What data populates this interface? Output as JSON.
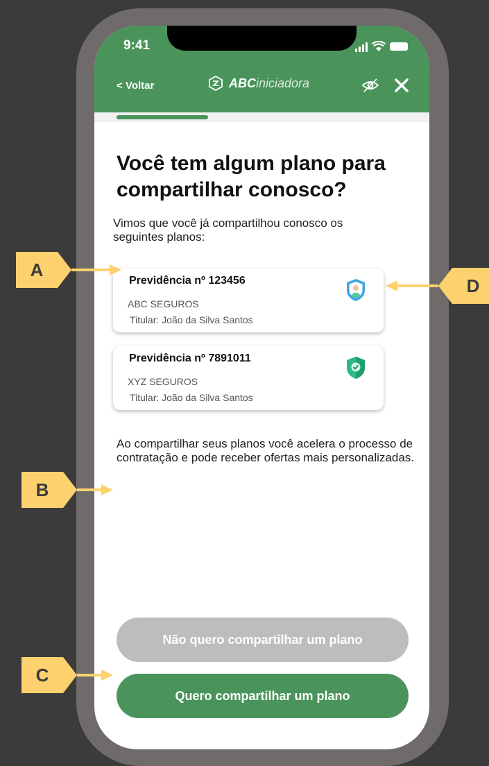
{
  "status_bar": {
    "time": "9:41"
  },
  "header": {
    "back_label": "< Voltar",
    "brand_strong": "ABC",
    "brand_light": "iniciadora"
  },
  "progress": {
    "fraction": 0.25
  },
  "title": "Você tem algum plano para compartilhar conosco?",
  "subtitle": "Vimos que você já compartilhou conosco os seguintes planos:",
  "plans": [
    {
      "title": "Previdência nº 123456",
      "company": "ABC SEGUROS",
      "holder": "Titular: João da Silva Santos",
      "icon": "shield-person-icon"
    },
    {
      "title": "Previdência nº 7891011",
      "company": "XYZ SEGUROS",
      "holder": "Titular: João da Silva Santos",
      "icon": "shield-check-icon"
    }
  ],
  "info_text": "Ao compartilhar seus planos você acelera o processo de contratação e pode receber ofertas mais personalizadas.",
  "buttons": {
    "decline": "Não quero compartilhar um plano",
    "accept": "Quero compartilhar um plano"
  },
  "annotations": {
    "a": "A",
    "b": "B",
    "c": "C",
    "d": "D"
  },
  "colors": {
    "brand": "#4a945c",
    "annotation": "#fdd26e",
    "disabled": "#bdbdbd",
    "background": "#3b3b3b"
  }
}
